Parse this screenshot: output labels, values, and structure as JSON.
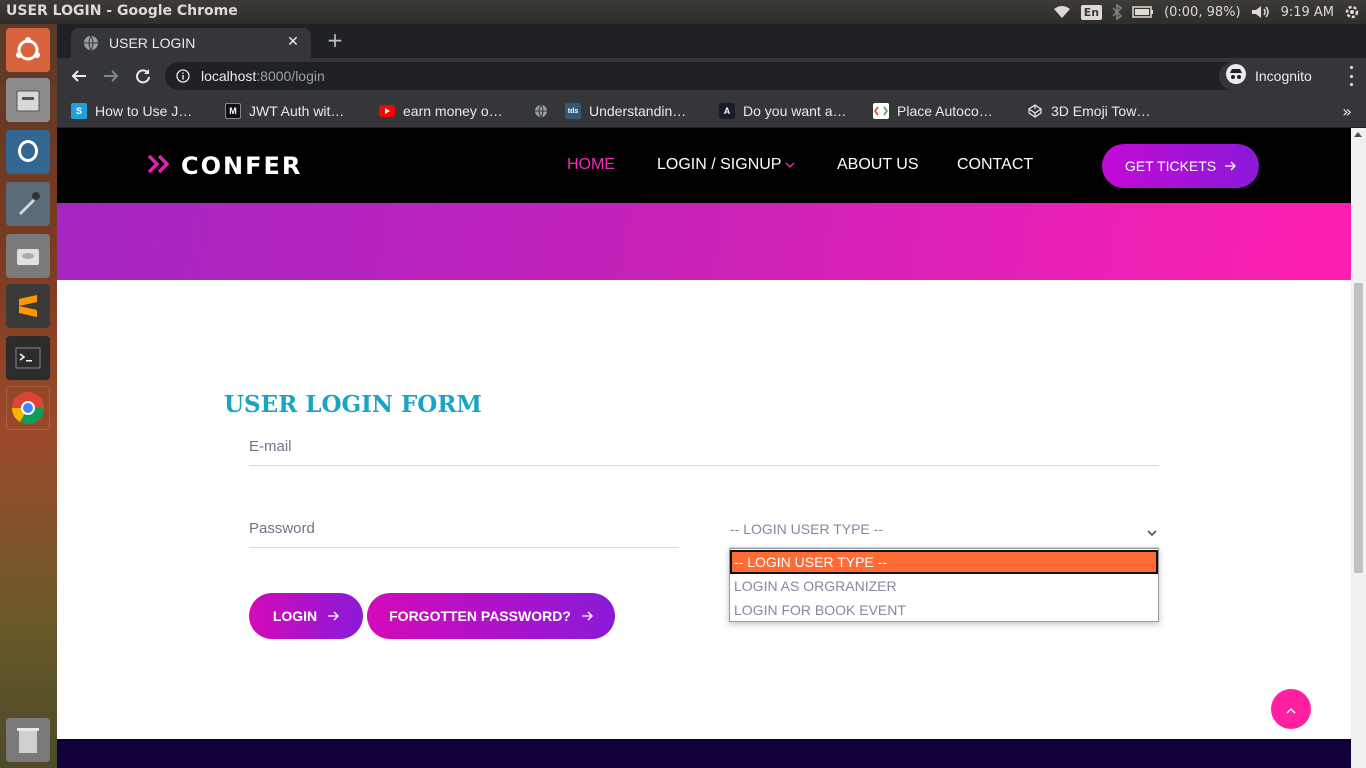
{
  "os": {
    "window_title": "USER LOGIN - Google Chrome",
    "lang": "En",
    "battery": "(0:00, 98%)",
    "time": "9:19 AM"
  },
  "browser": {
    "tab_title": "USER LOGIN",
    "url_host": "localhost",
    "url_rest": ":8000/login",
    "incognito_label": "Incognito",
    "bookmarks": [
      {
        "label": "How to Use J…",
        "icon": "S"
      },
      {
        "label": "JWT Auth wit…",
        "icon": "M"
      },
      {
        "label": "earn money o…",
        "icon": "youtube-icon"
      },
      {
        "label": "Understandin…",
        "icon": "tds"
      },
      {
        "label": "Do you want a…",
        "icon": "A"
      },
      {
        "label": "Place Autoco…",
        "icon": "code-icon"
      },
      {
        "label": "3D Emoji Tow…",
        "icon": "codepen-icon"
      }
    ],
    "bookmarks_more": "»"
  },
  "site": {
    "logo": "CONFER",
    "nav": {
      "home": "HOME",
      "login_signup": "LOGIN / SIGNUP",
      "about": "ABOUT US",
      "contact": "CONTACT"
    },
    "tickets_button": "GET TICKETS"
  },
  "form": {
    "title": "USER LOGIN FORM",
    "email_placeholder": "E-mail",
    "password_placeholder": "Password",
    "select_value": "-- LOGIN USER TYPE --",
    "options": [
      "-- LOGIN USER TYPE --",
      "LOGIN AS ORGRANIZER",
      "LOGIN FOR BOOK EVENT"
    ],
    "login_button": "LOGIN",
    "forgot_button": "FORGOTTEN PASSWORD?"
  },
  "colors": {
    "accent_pink": "#f22cb6",
    "title_blue": "#1aa3c6",
    "selected_option": "#ff6b35"
  }
}
